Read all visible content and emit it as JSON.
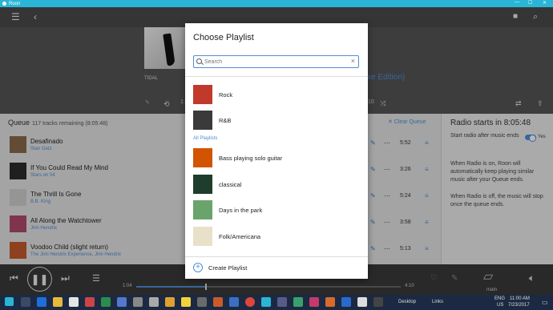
{
  "window": {
    "title": "Roon"
  },
  "hero": {
    "source": "TIDAL",
    "subtitle_fragment": "xe Edition)",
    "elapsed_short": "1:0",
    "remaining_short": "10"
  },
  "queue": {
    "title": "Queue",
    "summary": "117 tracks remaining (8:05:48)",
    "clear_label": "Clear Queue",
    "tracks": [
      {
        "title": "Desafinado",
        "artist": "Stan Getz",
        "duration": "5:52",
        "color": "#8a6a4a"
      },
      {
        "title": "If You Could Read My Mind",
        "artist": "Stars on 54",
        "duration": "3:26",
        "color": "#2c2c2c"
      },
      {
        "title": "The Thrill Is Gone",
        "artist": "B.B. King",
        "duration": "5:24",
        "color": "#cfcfcf"
      },
      {
        "title": "All Along the Watchtower",
        "artist": "Jimi Hendrix",
        "duration": "3:58",
        "color": "#b14a6a"
      },
      {
        "title": "Voodoo Child (slight return)",
        "artist": "The Jimi Hendrix Experience, Jimi Hendrix",
        "duration": "5:13",
        "color": "#c45a2a"
      }
    ]
  },
  "radio": {
    "title": "Radio starts in 8:05:48",
    "option": "Start radio after music ends",
    "toggle_label": "Yes",
    "toggle_on": true,
    "para1": "When Radio is on, Roon will automatically keep playing similar music after your Queue ends.",
    "para2": "When Radio is off, the music will stop once the queue ends."
  },
  "player": {
    "elapsed": "1:04",
    "total": "4:10",
    "progress": 0.26,
    "zone": "main"
  },
  "modal": {
    "title": "Choose Playlist",
    "search_placeholder": "Search",
    "recent": [
      {
        "label": "Rock",
        "color": "#c0392b"
      },
      {
        "label": "R&B",
        "color": "#3a3a3a"
      }
    ],
    "section_label": "All Playlists",
    "playlists": [
      {
        "label": "Bass playing solo guitar",
        "color": "#d35400"
      },
      {
        "label": "classical",
        "color": "#1f3d2b"
      },
      {
        "label": "Days in the park",
        "color": "#6aa36b"
      },
      {
        "label": "Folk/Americana",
        "color": "#e8e0c8"
      }
    ],
    "create_label": "Create Playlist"
  },
  "taskbar": {
    "desktop_label": "Desktop",
    "links_label": "Links",
    "lang": "ENG",
    "region": "US",
    "time": "11:00 AM",
    "date": "7/23/2017"
  }
}
